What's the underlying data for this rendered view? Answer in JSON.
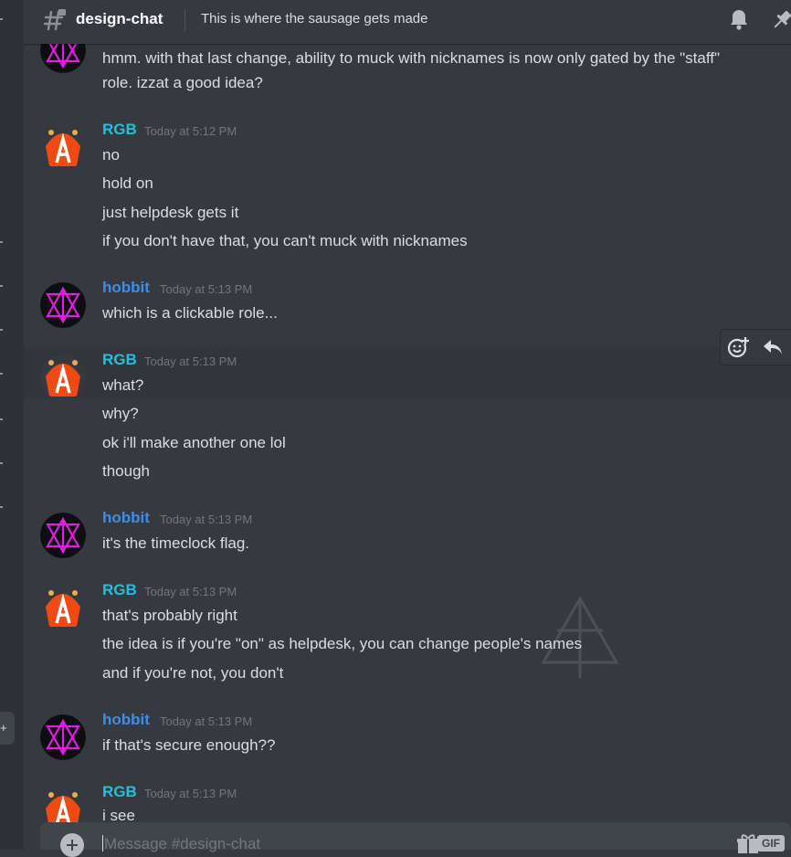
{
  "header": {
    "channel_name": "design-chat",
    "topic": "This is where the sausage gets made"
  },
  "messages": {
    "top_continuation": [
      "hmm.  with that last change, ability to muck with nicknames is now only gated by the \"staff\"",
      "role.  izzat a good idea?"
    ],
    "groups": [
      {
        "author": "RGB",
        "timestamp": "Today at 5:12 PM",
        "lines": [
          "no",
          "hold on",
          "just helpdesk gets it",
          "if you don't have that, you can't muck with nicknames"
        ]
      },
      {
        "author": "hobbit",
        "timestamp": "Today at 5:13 PM",
        "lines": [
          "which is a clickable role..."
        ]
      },
      {
        "author": "RGB",
        "timestamp": "Today at 5:13 PM",
        "lines": [
          "what?",
          "why?",
          "ok i'll make another one lol",
          "though"
        ]
      },
      {
        "author": "hobbit",
        "timestamp": "Today at 5:13 PM",
        "lines": [
          "it's the timeclock flag."
        ]
      },
      {
        "author": "RGB",
        "timestamp": "Today at 5:13 PM",
        "lines": [
          "that's probably right",
          "the idea is if you're \"on\" as helpdesk, you can change people's names",
          "and if you're not, you don't"
        ]
      },
      {
        "author": "hobbit",
        "timestamp": "Today at 5:13 PM",
        "lines": [
          "if that's secure enough??"
        ]
      },
      {
        "author": "RGB",
        "timestamp": "Today at 5:13 PM",
        "lines": [
          "i see"
        ]
      }
    ]
  },
  "composer": {
    "placeholder": "Message #design-chat",
    "gif_label": "GIF"
  },
  "colors": {
    "background": "#36393f",
    "rgb_name": "#1fc1dc",
    "hobbit_name": "#3d8ee8",
    "timestamp": "#72767d",
    "text": "#dcddde"
  },
  "icons": [
    "hashtag-icon",
    "bell-icon",
    "pin-icon",
    "add-reaction-icon",
    "reply-icon",
    "add-attachment-icon",
    "gift-icon",
    "gif-icon"
  ]
}
